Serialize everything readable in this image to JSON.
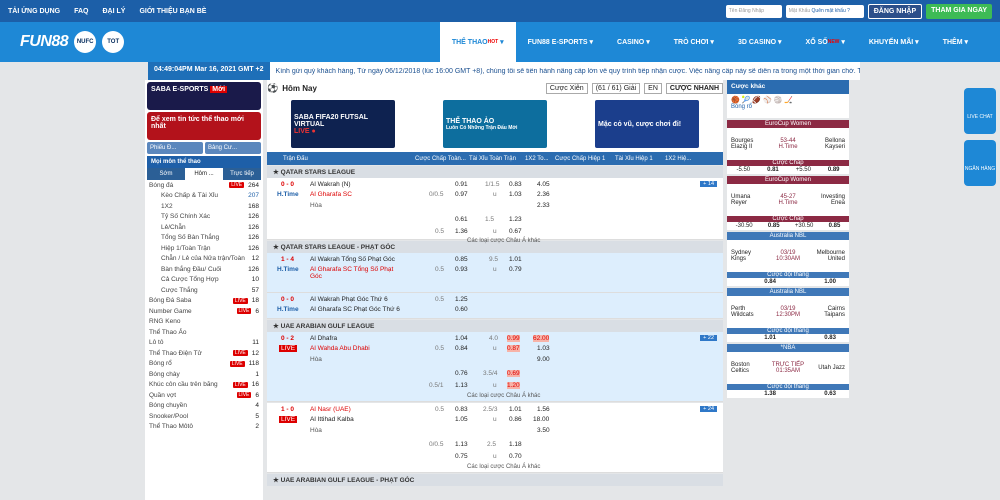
{
  "topbar": {
    "links": [
      "TẢI ỨNG DỤNG",
      "FAQ",
      "ĐẠI LÝ",
      "GIỚI THIỆU BẠN BÈ"
    ],
    "username_ph": "Tên Đăng Nhập",
    "password_ph": "Mật Khẩu",
    "forgot": "Quên mật khẩu ?",
    "login": "ĐĂNG NHẬP",
    "join": "THAM GIA NGAY"
  },
  "header": {
    "logo": "FUN88",
    "clubs": [
      "NUFC",
      "TOT"
    ],
    "nav": [
      "THỂ THAO",
      "FUN88 E-SPORTS",
      "CASINO",
      "TRÒ CHƠI",
      "3D CASINO",
      "XỔ SỐ",
      "KHUYẾN MÃI",
      "THÊM"
    ],
    "hot": "HOT",
    "new": "NEW"
  },
  "ticker": {
    "time": "04:49:04PM Mar 16, 2021 GMT +2",
    "text": "Kính gửi quý khách hàng, Từ ngày 06/12/2018 (lúc 16:00 GMT +8), chúng tôi sẽ tiến hành nâng cấp lớn về quy trình tiếp nhận cược. Việc nâng cấp này sẽ diễn ra trong một thời gian chờ. Tuy"
  },
  "left": {
    "b1": "SABA E-SPORTS",
    "b1badge": "Mới",
    "b2": "Để xem tin tức thể thao mới nhất",
    "tab1": "Phiếu Đ...",
    "tab2": "Bảng Cư...",
    "section": "Mọi môn thể thao",
    "t1": "Sớm",
    "t2": "Hôm ...",
    "t3": "Trực tiếp",
    "sports": [
      {
        "n": "Bóng đá",
        "live": true,
        "c": "264"
      },
      {
        "n": "Kèo Chấp & Tài Xỉu",
        "c": "207",
        "sub": true,
        "sel": true
      },
      {
        "n": "1X2",
        "c": "168",
        "sub": true
      },
      {
        "n": "Tỷ Số Chính Xác",
        "c": "126",
        "sub": true
      },
      {
        "n": "Lẻ/Chẵn",
        "c": "126",
        "sub": true
      },
      {
        "n": "Tổng Số Bàn Thắng",
        "c": "126",
        "sub": true
      },
      {
        "n": "Hiệp 1/Toàn Trận",
        "c": "126",
        "sub": true
      },
      {
        "n": "Chẵn / Lẻ của Nửa trận/Toàn",
        "c": "12",
        "sub": true
      },
      {
        "n": "Bàn thắng Đầu/ Cuối",
        "c": "126",
        "sub": true
      },
      {
        "n": "Cả Cược Tổng Hợp",
        "c": "10",
        "sub": true
      },
      {
        "n": "Cược Thắng",
        "c": "57",
        "sub": true
      },
      {
        "n": "Bóng Đá Saba",
        "live": true,
        "c": "18"
      },
      {
        "n": "Number Game",
        "live": true,
        "c": "6"
      },
      {
        "n": "RNG Keno",
        "c": ""
      },
      {
        "n": "Thể Thao Ảo",
        "c": ""
      },
      {
        "n": "Lô tô",
        "c": "11"
      },
      {
        "n": "Thể Thao Điện Tử",
        "live": true,
        "c": "12"
      },
      {
        "n": "Bóng rổ",
        "live": true,
        "c": "118"
      },
      {
        "n": "Bóng chày",
        "c": "1"
      },
      {
        "n": "Khúc côn cầu trên băng",
        "live": true,
        "c": "16"
      },
      {
        "n": "Quần vợt",
        "live": true,
        "c": "6"
      },
      {
        "n": "Bóng chuyền",
        "c": "4"
      },
      {
        "n": "Snooker/Pool",
        "c": "5"
      },
      {
        "n": "Thể Thao Môtô",
        "c": "2"
      }
    ]
  },
  "main": {
    "today": "Hôm Nay",
    "mix": "Cược Xiên",
    "count": "(61 / 61) Giải",
    "lang": "EN",
    "quick": "CƯỢC NHANH",
    "ads": [
      "SABA FIFA20 FUTSAL VIRTUAL",
      "THỂ THAO ẢO",
      "Mặc cỏ vũ, cược chơi đi!"
    ],
    "ad_live": "LIVE ●",
    "ad_sub": "Luôn Có Những Trận Đấu Mới",
    "cols": [
      "Trận Đấu",
      "Cược Chấp Toàn...",
      "Tài Xỉu Toàn Trận",
      "1X2 To...",
      "Cược Chấp Hiệp 1",
      "Tài Xỉu Hiệp 1",
      "1X2 Hiệ..."
    ],
    "more": "Các loại cược Châu Á khác",
    "leagues": [
      "QATAR STARS LEAGUE",
      "QATAR STARS LEAGUE - PHẠT GÓC",
      "UAE ARABIAN GULF LEAGUE",
      "UAE ARABIAN GULF LEAGUE - PHẠT GÓC"
    ],
    "m1": {
      "score": "0 - 0",
      "st": "H.Time",
      "home": "Al Wakrah (N)",
      "away": "Al Gharafa SC",
      "draw": "Hòa",
      "h1": "0.91",
      "hc": "0/0.5",
      "h2": "0.97",
      "ou": "1/1.5",
      "o1": "0.83",
      "ouu": "u",
      "o2": "1.03",
      "x1": "4.05",
      "x2": "2.36",
      "x3": "2.33",
      "r2a": "0.61",
      "r2b": "1.36",
      "r2hc": "0.5",
      "r2ou": "1.5",
      "r2o1": "1.23",
      "r2u": "u",
      "r2o2": "0.67",
      "cnt": "+ 14"
    },
    "m2": {
      "score": "1 - 4",
      "st": "H.Time",
      "home": "Al Wakrah Tổng Số Phạt Góc",
      "away": "Al Gharafa SC Tổng Số Phạt Góc",
      "h1": "0.85",
      "h2": "0.93",
      "hc": "0.5",
      "ou": "9.5",
      "o1": "1.01",
      "ouu": "u",
      "o2": "0.79"
    },
    "m3": {
      "score": "0 - 0",
      "st": "H.Time",
      "home": "Al Wakrah Phạt Góc Thứ 6",
      "away": "Al Gharafa SC Phạt Góc Thứ 6",
      "h1": "1.25",
      "h2": "0.60",
      "hc": "0.5"
    },
    "m4": {
      "score": "0 - 2",
      "st": "LIVE",
      "home": "Al Dhafra",
      "away": "Al Wahda Abu Dhabi",
      "draw": "Hòa",
      "h1": "1.04",
      "h2": "0.84",
      "hc": "0.5",
      "ou": "4.0",
      "o1": "0.99",
      "ouu": "u",
      "o2": "0.87",
      "x1": "62.00",
      "x2": "1.03",
      "x3": "9.00",
      "r2a": "0.76",
      "r2b": "1.13",
      "r2hc": "0.5/1",
      "r2ou": "3.5/4",
      "r2o1": "0.69",
      "r2u": "u",
      "r2o2": "1.20",
      "cnt": "+ 22"
    },
    "m5": {
      "score": "1 - 0",
      "st": "LIVE",
      "home": "Al Nasr (UAE)",
      "away": "Al Ittihad Kalba",
      "draw": "Hòa",
      "h1": "0.83",
      "h2": "1.05",
      "hc": "0.5",
      "ou": "2.5/3",
      "o1": "1.01",
      "ouu": "u",
      "o2": "0.86",
      "x1": "1.56",
      "x2": "18.00",
      "x3": "3.50",
      "r2a": "1.13",
      "r2b": "0.75",
      "r2hc": "0/0.5",
      "r2ou": "2.5",
      "r2o1": "1.18",
      "r2u": "u",
      "r2o2": "0.70",
      "cnt": "+ 24"
    }
  },
  "right": {
    "title": "Cược khác",
    "sport": "Bóng rổ",
    "cards": [
      {
        "league": "EuroCup Women",
        "h": "Bourges Elazig Il",
        "hs": "53-44",
        "st": "H.Time",
        "a": "Bellona Kayseri",
        "ml": "Cược Chấp",
        "o1": "-5.50",
        "v1": "0.81",
        "o2": "+5.50",
        "v2": "0.89",
        "nba": false
      },
      {
        "league": "EuroCup Women",
        "h": "Umana Reyer",
        "hs": "45-27",
        "st": "H.Time",
        "a": "Investing Enea",
        "ml": "Cược Chấp",
        "o1": "-30.50",
        "v1": "0.85",
        "o2": "+30.50",
        "v2": "0.85",
        "nba": false
      },
      {
        "league": "Australia NBL",
        "h": "Sydney Kings",
        "hs": "03/19",
        "st": "10:30AM",
        "a": "Melbourne United",
        "ml": "Cược đội thắng",
        "o1": "",
        "v1": "0.84",
        "o2": "",
        "v2": "1.00",
        "nba": true
      },
      {
        "league": "Australia NBL",
        "h": "Perth Wildcats",
        "hs": "03/19",
        "st": "12:30PM",
        "a": "Cairns Taipans",
        "ml": "Cược đội thắng",
        "o1": "",
        "v1": "1.01",
        "o2": "",
        "v2": "0.83",
        "nba": true
      },
      {
        "league": "*NBA",
        "h": "Boston Celtics",
        "hs": "TRỰC TIẾP",
        "st": "01:35AM",
        "a": "Utah Jazz",
        "ml": "Cược đội thắng",
        "o1": "",
        "v1": "1.38",
        "o2": "",
        "v2": "0.63",
        "nba": true
      }
    ]
  },
  "float": {
    "chat": "LIVE CHAT",
    "bank": "NGÂN HÀNG"
  }
}
